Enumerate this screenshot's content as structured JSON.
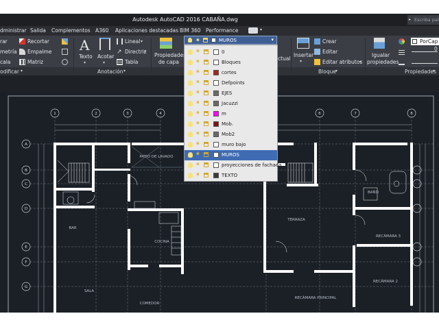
{
  "window": {
    "title": "Autodesk AutoCAD 2016    CABAÑA.dwg",
    "search_placeholder": "Escriba palab"
  },
  "menu": [
    "dministrar",
    "Salida",
    "Complementos",
    "A360",
    "Aplicaciones destacadas",
    "BIM 360",
    "Performance"
  ],
  "ribbon": {
    "modify_tools": [
      "rar",
      "metría",
      "cala"
    ],
    "trim": "Recortar",
    "fillet": "Empalme",
    "array": "Matriz",
    "text": "Texto",
    "dimension": "Acotar",
    "linear": "Lineal",
    "leader": "Directriz",
    "table": "Tabla",
    "layer_props": [
      "Propiedades",
      "de capa"
    ],
    "actual": "ctual",
    "insert": "Insertar",
    "create": "Crear",
    "edit": "Editar",
    "edit_attr": "Editar atributos",
    "match_props": [
      "Igualar",
      "propiedades"
    ],
    "bylayer": "PorCap",
    "lineweight_label": "0",
    "panels": {
      "modify": "odificar",
      "annotation": "Anotación",
      "block": "Bloque",
      "properties": "Propiedades"
    }
  },
  "layer_current": "MUROS",
  "layers": [
    {
      "name": "0",
      "color": "#ffffff"
    },
    {
      "name": "Bloques",
      "color": "#ffffff"
    },
    {
      "name": "cortes",
      "color": "#a5271b"
    },
    {
      "name": "Defpoints",
      "color": "#ffffff"
    },
    {
      "name": "EJES",
      "color": "#6a6a6a"
    },
    {
      "name": "Jacuzzi",
      "color": "#6a6a6a"
    },
    {
      "name": "m",
      "color": "#ff00ff"
    },
    {
      "name": "Mob.",
      "color": "#7a1712"
    },
    {
      "name": "Mob2",
      "color": "#6a6a6a"
    },
    {
      "name": "muro bajo",
      "color": "#ffffff"
    },
    {
      "name": "MUROS",
      "color": "#ffffff",
      "selected": true
    },
    {
      "name": "proyecciones de fachada",
      "color": "#ffffff"
    },
    {
      "name": "TEXTO",
      "color": "#3a3a3a"
    }
  ],
  "plan": {
    "axis_labels": [
      "1",
      "2",
      "3",
      "4",
      "5",
      "6",
      "7",
      "8"
    ],
    "row_labels": [
      "A",
      "B",
      "C",
      "D",
      "E",
      "F",
      "G"
    ],
    "rooms": [
      "PATIO DE LAVADO",
      "BAR",
      "COCINA",
      "SALA",
      "COMEDOR",
      "TERRAZA",
      "RECÁMARA PRINCIPAL",
      "RECÁMARA 3",
      "RECÁMARA 2",
      "BAÑO"
    ]
  },
  "colors": {
    "accent": "#3f6bb2",
    "background": "#1b2027",
    "walls": "#ffffff"
  }
}
